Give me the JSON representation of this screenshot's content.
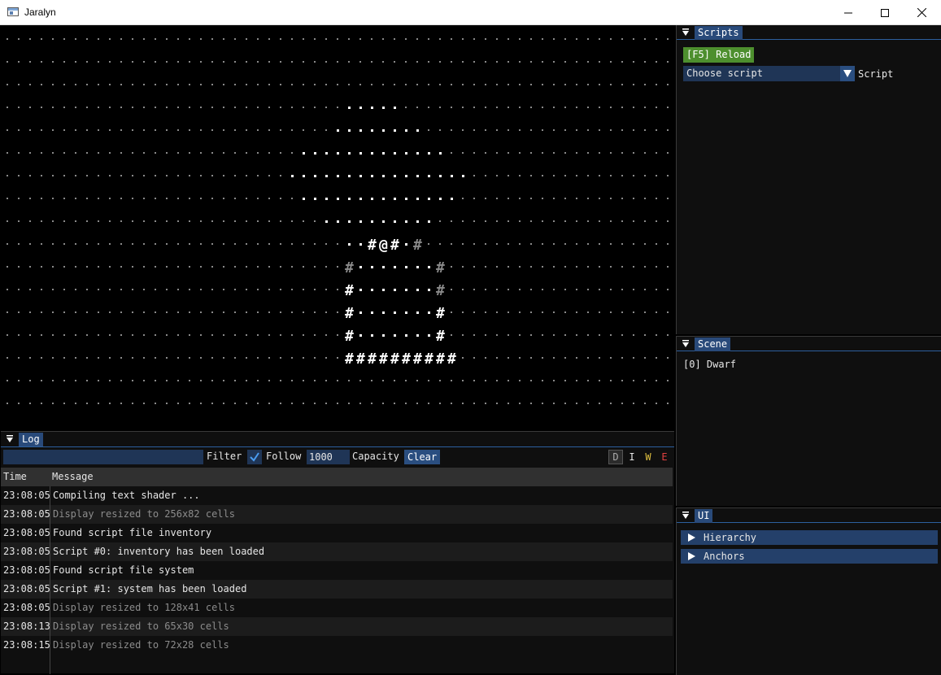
{
  "window": {
    "title": "Jaralyn"
  },
  "viewport": {
    "map_rows": [
      "............................................................",
      "............................................................",
      "............................................................",
      "............................................................",
      "............................................................",
      "............................................................",
      "............................................................",
      "............................................................",
      "............................................................",
      "................................#@#.#........................",
      "..............................#.......#.....................",
      "..............................#.......#.....................",
      "..............................#.......#.....................",
      "..............................#.......#.....................",
      "..............................##########....................",
      "............................................................",
      "............................................................"
    ]
  },
  "log": {
    "title": "Log",
    "filter_label": "Filter",
    "follow_label": "Follow",
    "follow_checked": true,
    "capacity_value": "1000",
    "capacity_label": "Capacity",
    "clear_label": "Clear",
    "levels": {
      "debug": "D",
      "info": "I",
      "warn": "W",
      "error": "E"
    },
    "level_colors": {
      "warn": "#e0c040",
      "error": "#e04040"
    },
    "columns": {
      "time": "Time",
      "message": "Message"
    },
    "rows": [
      {
        "time": "23:08:05",
        "message": "Compiling text shader ...",
        "level": "info"
      },
      {
        "time": "23:08:05",
        "message": "Display resized to 256x82 cells",
        "level": "debug"
      },
      {
        "time": "23:08:05",
        "message": "Found script file inventory",
        "level": "info"
      },
      {
        "time": "23:08:05",
        "message": "Script #0: inventory has been loaded",
        "level": "info"
      },
      {
        "time": "23:08:05",
        "message": "Found script file system",
        "level": "info"
      },
      {
        "time": "23:08:05",
        "message": "Script #1: system has been loaded",
        "level": "info"
      },
      {
        "time": "23:08:05",
        "message": "Display resized to 128x41 cells",
        "level": "debug"
      },
      {
        "time": "23:08:13",
        "message": "Display resized to 65x30 cells",
        "level": "debug"
      },
      {
        "time": "23:08:15",
        "message": "Display resized to 72x28 cells",
        "level": "debug"
      }
    ]
  },
  "scripts": {
    "title": "Scripts",
    "reload_label": "[F5] Reload",
    "combo_value": "Choose script",
    "combo_label": "Script"
  },
  "scene": {
    "title": "Scene",
    "items": [
      "[0] Dwarf"
    ]
  },
  "ui": {
    "title": "UI",
    "nodes": [
      "Hierarchy",
      "Anchors"
    ]
  },
  "colors": {
    "accent": "#2a4e80",
    "header_tab": "#294a7a",
    "frame_bg": "#1f3556",
    "reload_green": "#4d8f2e"
  }
}
